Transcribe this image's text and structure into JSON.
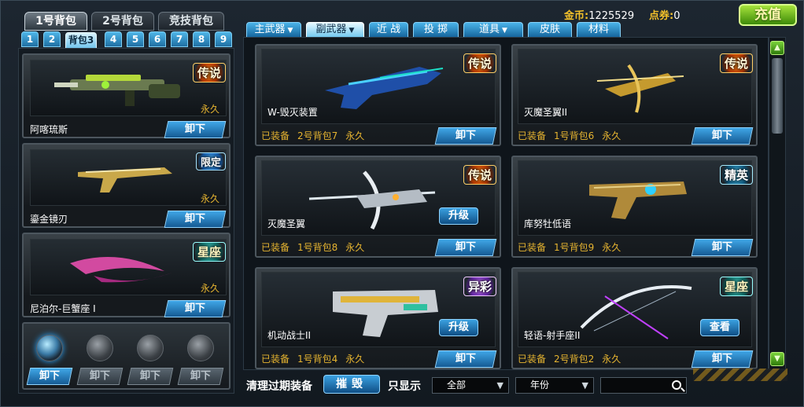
{
  "bags": {
    "tabs": [
      "1号背包",
      "2号背包",
      "竞技背包"
    ],
    "active": 0,
    "numbers": [
      "1",
      "2",
      "背包3",
      "4",
      "5",
      "6",
      "7",
      "8",
      "9"
    ],
    "active_number": 2
  },
  "currency": {
    "gold_label": "金币:",
    "gold_value": "1225529",
    "points_label": "点券:",
    "points_value": "0",
    "recharge_label": "充值"
  },
  "categories": [
    {
      "label": "主武器",
      "dropdown": true
    },
    {
      "label": "副武器",
      "dropdown": true,
      "active": true
    },
    {
      "label": "近 战",
      "dropdown": false
    },
    {
      "label": "投 掷",
      "dropdown": false
    },
    {
      "label": "道具",
      "dropdown": true
    },
    {
      "label": "皮肤",
      "dropdown": false
    },
    {
      "label": "材料",
      "dropdown": false
    }
  ],
  "left_items": [
    {
      "name": "阿喀琉斯",
      "duration": "永久",
      "badge": "传说",
      "button": "卸下"
    },
    {
      "name": "鎏金镜刃",
      "duration": "永久",
      "badge": "限定",
      "button": "卸下"
    },
    {
      "name": "尼泊尔-巨蟹座 I",
      "duration": "永久",
      "badge": "星座",
      "button": "卸下"
    }
  ],
  "grenade_slots": [
    {
      "button": "卸下",
      "active": true
    },
    {
      "button": "卸下",
      "active": false
    },
    {
      "button": "卸下",
      "active": false
    },
    {
      "button": "卸下",
      "active": false
    }
  ],
  "items": [
    {
      "name": "W-毁灭装置",
      "badge": "传说",
      "equip": "已装备",
      "bag": "2号背包7",
      "duration": "永久",
      "button": "卸下",
      "action": ""
    },
    {
      "name": "灭魔圣翼II",
      "badge": "传说",
      "equip": "已装备",
      "bag": "1号背包6",
      "duration": "永久",
      "button": "卸下",
      "action": ""
    },
    {
      "name": "灭魔圣翼",
      "badge": "传说",
      "equip": "已装备",
      "bag": "1号背包8",
      "duration": "永久",
      "button": "卸下",
      "action": "升级"
    },
    {
      "name": "库努牡低语",
      "badge": "精英",
      "equip": "已装备",
      "bag": "1号背包9",
      "duration": "永久",
      "button": "卸下",
      "action": ""
    },
    {
      "name": "机动战士II",
      "badge": "异彩",
      "equip": "已装备",
      "bag": "1号背包4",
      "duration": "永久",
      "button": "卸下",
      "action": "升级"
    },
    {
      "name": "轻语-射手座II",
      "badge": "星座",
      "equip": "已装备",
      "bag": "2号背包2",
      "duration": "永久",
      "button": "卸下",
      "action": "查看"
    }
  ],
  "bottom": {
    "clear_label": "清理过期装备",
    "destroy_label": "摧毁",
    "show_only_label": "只显示",
    "filter_all": "全部",
    "filter_year": "年份"
  },
  "colors": {
    "accent_blue": "#3fa6e6",
    "gold_text": "#e6b430",
    "recharge_green": "#7ad23a"
  },
  "icons": {
    "scroll_up": "triangle-up-icon",
    "scroll_down": "triangle-down-icon",
    "search": "magnifier-icon",
    "dropdown": "chevron-down-icon"
  }
}
